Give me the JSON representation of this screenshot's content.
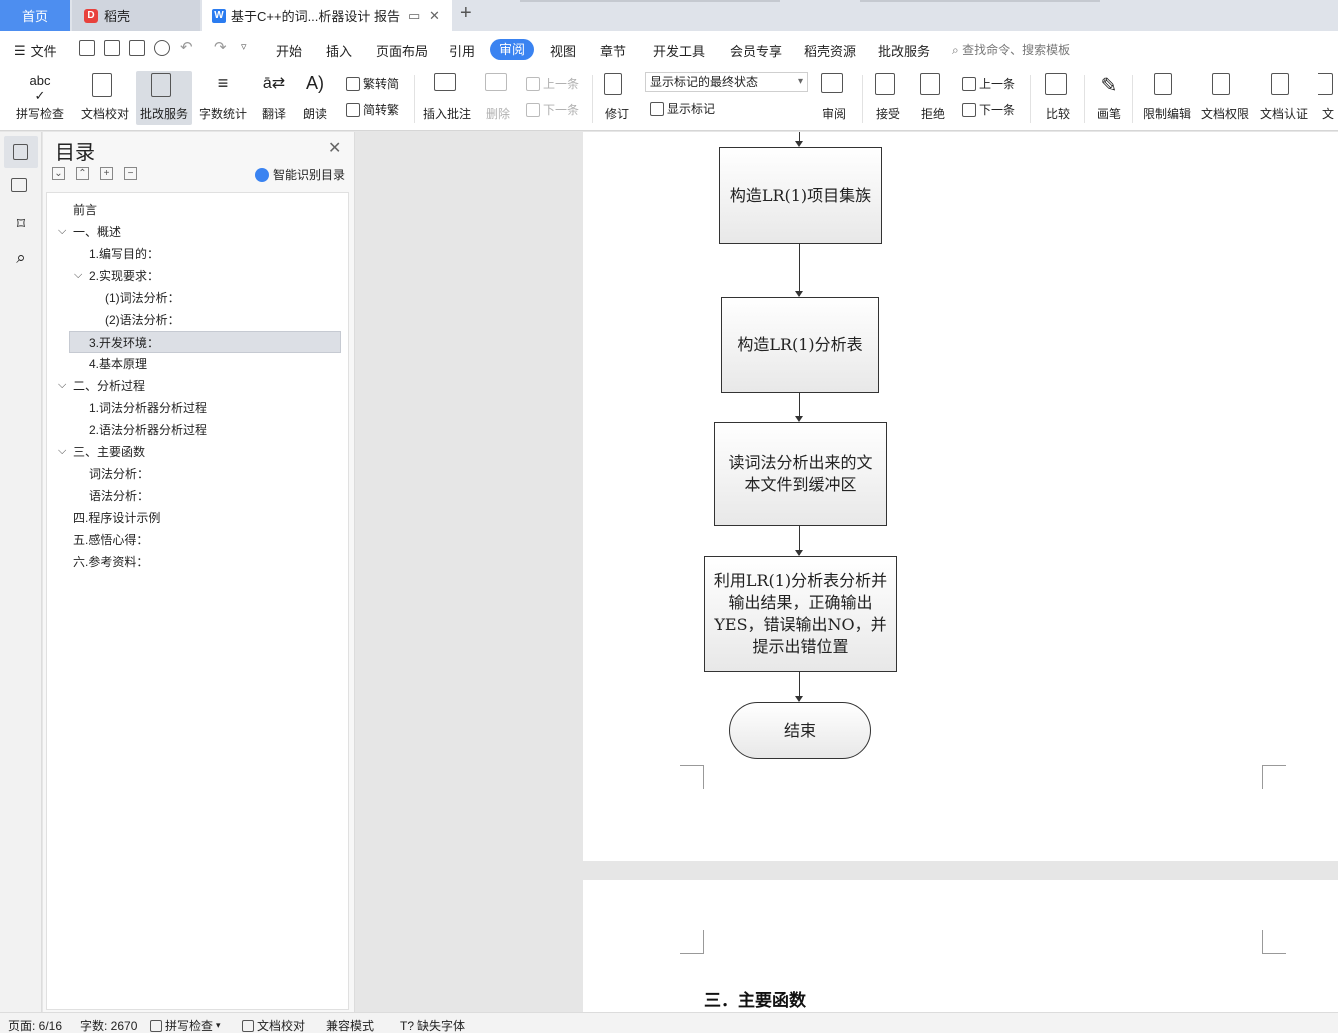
{
  "tabs": {
    "home": "首页",
    "daoke": "稻壳",
    "doc": "基于C++的词...析器设计 报告",
    "add": "+"
  },
  "menu": {
    "file": "文件",
    "items": [
      "开始",
      "插入",
      "页面布局",
      "引用",
      "审阅",
      "视图",
      "章节",
      "开发工具",
      "会员专享",
      "稻壳资源",
      "批改服务"
    ],
    "active": "审阅",
    "search": "查找命令、搜索模板"
  },
  "ribbon": {
    "spell": "拼写检查",
    "proof": "文档校对",
    "review_service": "批改服务",
    "wordcount": "字数统计",
    "translate": "翻译",
    "read": "朗读",
    "t2s": "繁转简",
    "s2t": "简转繁",
    "insert_comment": "插入批注",
    "delete": "删除",
    "prev1": "上一条",
    "next1": "下一条",
    "revise": "修订",
    "markup_state": "显示标记的最终状态",
    "show_markup": "显示标记",
    "review": "审阅",
    "accept": "接受",
    "reject": "拒绝",
    "prev2": "上一条",
    "next2": "下一条",
    "compare": "比较",
    "pen": "画笔",
    "restrict": "限制编辑",
    "permission": "文档权限",
    "certify": "文档认证",
    "more": "文"
  },
  "toc": {
    "title": "目录",
    "smart": "智能识别目录",
    "items": [
      "前言",
      "一、概述",
      "1.编写目的：",
      "2.实现要求：",
      "(1)词法分析：",
      "(2)语法分析：",
      "3.开发环境：",
      "4.基本原理",
      "二、分析过程",
      "1.词法分析器分析过程",
      "2.语法分析器分析过程",
      "三、主要函数",
      "词法分析：",
      "语法分析：",
      "四.程序设计示例",
      "五.感悟心得：",
      "六.参考资料："
    ]
  },
  "flowchart": {
    "steps": [
      "构造LR(1)项目集族",
      "构造LR(1)分析表",
      "读词法分析出来的文本文件到缓冲区",
      "利用LR(1)分析表分析并输出结果，正确输出YES，错误输出NO，并提示出错位置",
      "结束"
    ]
  },
  "page2": {
    "heading": "三．主要函数"
  },
  "status": {
    "page": "页面: 6/16",
    "words": "字数: 2670",
    "spell": "拼写检查",
    "proof": "文档校对",
    "compat": "兼容模式",
    "missing_font": "缺失字体"
  }
}
